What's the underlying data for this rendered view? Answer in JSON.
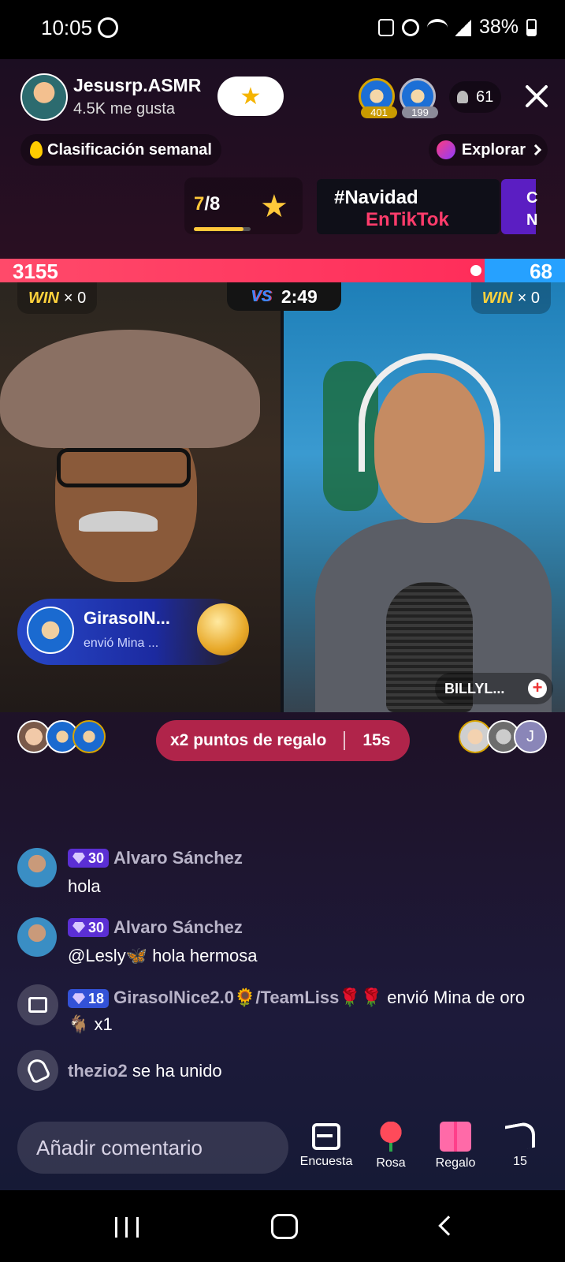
{
  "status_bar": {
    "time": "10:05",
    "battery": "38%"
  },
  "host": {
    "name": "Jesusrp.ASMR",
    "likes": "4.5K me gusta"
  },
  "top_viewers": [
    {
      "count": "401"
    },
    {
      "count": "199"
    }
  ],
  "viewer_count": "61",
  "weekly_ranking": "Clasificación semanal",
  "explore": "Explorar",
  "event": {
    "current": "7",
    "total": "/8",
    "progress": 0.875
  },
  "banner": {
    "line1": "#Navidad",
    "line2": "EnTikTok",
    "next": "C N"
  },
  "battle": {
    "left_score": "3155",
    "right_score": "68",
    "vs": "VS",
    "timer": "2:49",
    "win_word": "WIN",
    "left_wins": "× 0",
    "right_wins": "× 0",
    "opponent_tag": "BILLYL..."
  },
  "gift_toast": {
    "name": "GirasolN...",
    "sub": "envió Mina ..."
  },
  "bonus": {
    "label": "x2 puntos de regalo",
    "time": "15s"
  },
  "supporters_right_initial": "J",
  "chat": [
    {
      "level": "30",
      "user": "Alvaro Sánchez",
      "message": "hola"
    },
    {
      "level": "30",
      "user": "Alvaro Sánchez",
      "message": "@Lesly🦋 hola hermosa"
    }
  ],
  "gift_event": {
    "level": "18",
    "user": "GirasolNice2.0🌻/TeamLiss🌹🌹",
    "text": " envió Mina de oro 🐐 x1"
  },
  "join_event": {
    "user": "thezio2",
    "text": " se ha unido"
  },
  "bottom": {
    "comment_placeholder": "Añadir comentario",
    "poll": "Encuesta",
    "rose": "Rosa",
    "gift": "Regalo",
    "share_count": "15"
  },
  "colors": {
    "left_team": "#ff2d5a",
    "right_team": "#26a1ff",
    "accent": "#ffc83a"
  }
}
